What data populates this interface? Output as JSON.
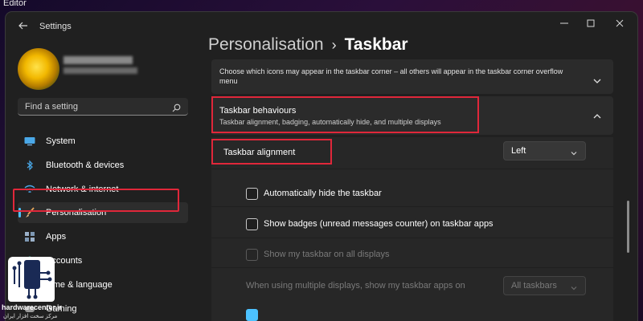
{
  "desktop": {
    "editor_label": "Editor"
  },
  "window": {
    "title": "Settings"
  },
  "sidebar": {
    "search_placeholder": "Find a setting",
    "items": [
      {
        "label": "System",
        "icon": "monitor-icon"
      },
      {
        "label": "Bluetooth & devices",
        "icon": "bluetooth-icon"
      },
      {
        "label": "Network & internet",
        "icon": "wifi-icon"
      },
      {
        "label": "Personalisation",
        "icon": "brush-icon",
        "active": true
      },
      {
        "label": "Apps",
        "icon": "apps-icon"
      },
      {
        "label": "Accounts",
        "icon": "person-icon"
      },
      {
        "label": "Time & language",
        "icon": "clock-icon"
      },
      {
        "label": "Gaming",
        "icon": "gamepad-icon"
      }
    ]
  },
  "main": {
    "breadcrumb": {
      "parent": "Personalisation",
      "separator": "›",
      "current": "Taskbar"
    },
    "corner_overflow": {
      "description": "Choose which icons may appear in the taskbar corner – all others will appear in the taskbar corner overflow menu"
    },
    "behaviours": {
      "title": "Taskbar behaviours",
      "subtitle": "Taskbar alignment, badging, automatically hide, and multiple displays",
      "alignment_label": "Taskbar alignment",
      "alignment_value": "Left",
      "auto_hide_label": "Automatically hide the taskbar",
      "auto_hide_checked": false,
      "badges_label": "Show badges (unread messages counter) on taskbar apps",
      "badges_checked": false,
      "all_displays_label": "Show my taskbar on all displays",
      "all_displays_checked": false,
      "multi_display_label": "When using multiple displays, show my taskbar apps on",
      "multi_display_value": "All taskbars"
    }
  },
  "watermark": {
    "site": "hardwarecenter.ir",
    "tagline": "مرکز سخت افزار ایران"
  },
  "colors": {
    "accent": "#4cc2ff",
    "highlight_box": "#e0273a",
    "window_bg": "#202020",
    "card_bg": "#2b2b2b"
  }
}
